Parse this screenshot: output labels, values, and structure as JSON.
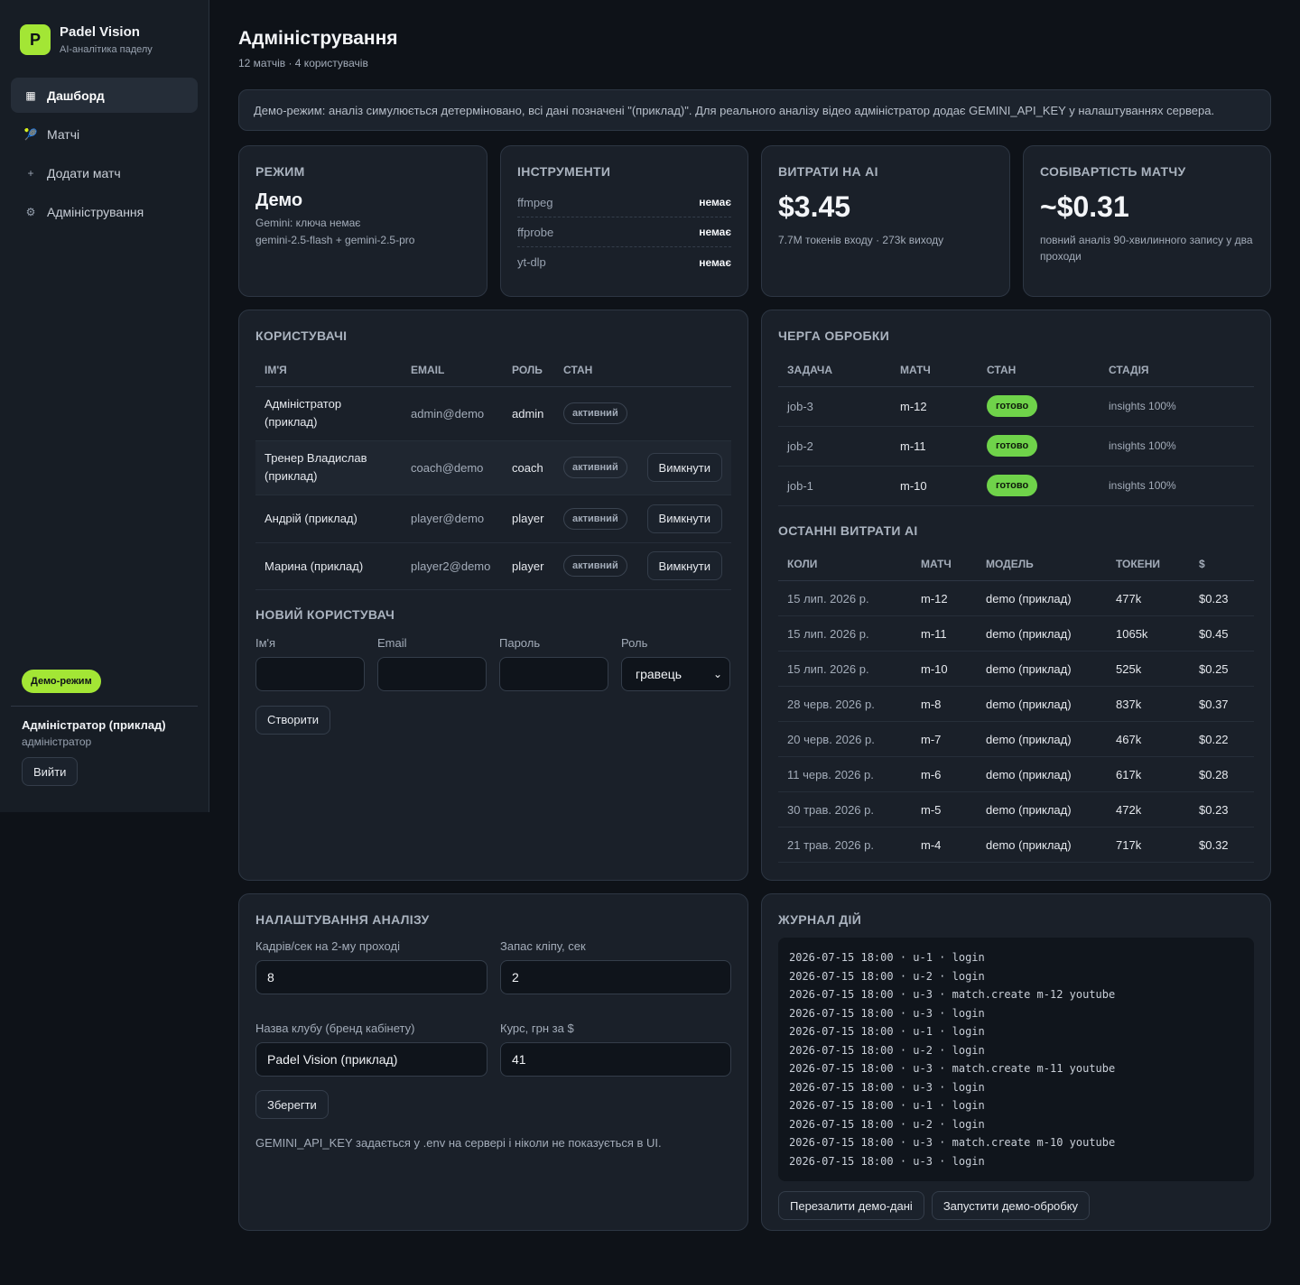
{
  "brand": {
    "logo_letter": "P",
    "name": "Padel Vision",
    "subtitle": "AI-аналітика паделу"
  },
  "nav": [
    {
      "icon": "dashboard-icon",
      "label": "Дашборд",
      "active": true
    },
    {
      "icon": "racket-icon",
      "label": "Матчі"
    },
    {
      "icon": "plus-icon",
      "label": "Додати матч"
    },
    {
      "icon": "gear-icon",
      "label": "Адміністрування"
    }
  ],
  "sidebar_footer": {
    "demo_badge": "Демо-режим",
    "user_name": "Адміністратор (приклад)",
    "user_role": "адміністратор",
    "logout": "Вийти"
  },
  "page": {
    "title": "Адміністрування",
    "subtitle": "12 матчів · 4 користувачів"
  },
  "notice": "Демо-режим: аналіз симулюється детерміновано, всі дані позначені \"(приклад)\". Для реального аналізу відео адміністратор додає GEMINI_API_KEY у налаштуваннях сервера.",
  "mode": {
    "title": "Режим",
    "value": "Демо",
    "line1": "Gemini: ключа немає",
    "line2": "gemini-2.5-flash + gemini-2.5-pro"
  },
  "tools": {
    "title": "Інструменти",
    "items": [
      {
        "name": "ffmpeg",
        "status": "немає"
      },
      {
        "name": "ffprobe",
        "status": "немає"
      },
      {
        "name": "yt-dlp",
        "status": "немає"
      }
    ]
  },
  "ai_cost": {
    "title": "Витрати на AI",
    "value": "$3.45",
    "sub": "7.7M токенів входу · 273k виходу"
  },
  "match_cost": {
    "title": "Собівартість матчу",
    "value": "~$0.31",
    "sub": "повний аналіз 90-хвилинного запису у два проходи"
  },
  "users": {
    "title": "Користувачі",
    "columns": [
      "Ім'я",
      "Email",
      "Роль",
      "Стан"
    ],
    "rows": [
      {
        "name": "Адміністратор (приклад)",
        "email": "admin@demo",
        "role": "admin",
        "state": "активний",
        "action": ""
      },
      {
        "name": "Тренер Владислав (приклад)",
        "email": "coach@demo",
        "role": "coach",
        "state": "активний",
        "action": "Вимкнути"
      },
      {
        "name": "Андрій (приклад)",
        "email": "player@demo",
        "role": "player",
        "state": "активний",
        "action": "Вимкнути"
      },
      {
        "name": "Марина (приклад)",
        "email": "player2@demo",
        "role": "player",
        "state": "активний",
        "action": "Вимкнути"
      }
    ]
  },
  "new_user": {
    "title": "Новий користувач",
    "name_label": "Ім'я",
    "email_label": "Email",
    "password_label": "Пароль",
    "role_label": "Роль",
    "role_value": "гравець",
    "create": "Створити"
  },
  "queue": {
    "title": "Черга обробки",
    "columns": [
      "Задача",
      "Матч",
      "Стан",
      "Стадія"
    ],
    "rows": [
      {
        "job": "job-3",
        "match": "m-12",
        "state": "готово",
        "stage": "insights 100%"
      },
      {
        "job": "job-2",
        "match": "m-11",
        "state": "готово",
        "stage": "insights 100%"
      },
      {
        "job": "job-1",
        "match": "m-10",
        "state": "готово",
        "stage": "insights 100%"
      }
    ]
  },
  "costs": {
    "title": "Останні витрати AI",
    "columns": [
      "Коли",
      "Матч",
      "Модель",
      "Токени",
      "$"
    ],
    "rows": [
      {
        "when": "15 лип. 2026 р.",
        "match": "m-12",
        "model": "demo (приклад)",
        "tokens": "477k",
        "usd": "$0.23"
      },
      {
        "when": "15 лип. 2026 р.",
        "match": "m-11",
        "model": "demo (приклад)",
        "tokens": "1065k",
        "usd": "$0.45"
      },
      {
        "when": "15 лип. 2026 р.",
        "match": "m-10",
        "model": "demo (приклад)",
        "tokens": "525k",
        "usd": "$0.25"
      },
      {
        "when": "28 черв. 2026 р.",
        "match": "m-8",
        "model": "demo (приклад)",
        "tokens": "837k",
        "usd": "$0.37"
      },
      {
        "when": "20 черв. 2026 р.",
        "match": "m-7",
        "model": "demo (приклад)",
        "tokens": "467k",
        "usd": "$0.22"
      },
      {
        "when": "11 черв. 2026 р.",
        "match": "m-6",
        "model": "demo (приклад)",
        "tokens": "617k",
        "usd": "$0.28"
      },
      {
        "when": "30 трав. 2026 р.",
        "match": "m-5",
        "model": "demo (приклад)",
        "tokens": "472k",
        "usd": "$0.23"
      },
      {
        "when": "21 трав. 2026 р.",
        "match": "m-4",
        "model": "demo (приклад)",
        "tokens": "717k",
        "usd": "$0.32"
      }
    ]
  },
  "settings": {
    "title": "Налаштування аналізу",
    "fps_label": "Кадрів/сек на 2-му проході",
    "fps_value": "8",
    "clip_label": "Запас кліпу, сек",
    "clip_value": "2",
    "club_label": "Назва клубу (бренд кабінету)",
    "club_value": "Padel Vision (приклад)",
    "rate_label": "Курс, грн за $",
    "rate_value": "41",
    "save": "Зберегти",
    "note": "GEMINI_API_KEY задається у .env на сервері і ніколи не показується в UI."
  },
  "log": {
    "title": "Журнал дій",
    "lines": [
      "2026-07-15 18:00 · u-1 · login",
      "2026-07-15 18:00 · u-2 · login",
      "2026-07-15 18:00 · u-3 · match.create m-12 youtube",
      "2026-07-15 18:00 · u-3 · login",
      "2026-07-15 18:00 · u-1 · login",
      "2026-07-15 18:00 · u-2 · login",
      "2026-07-15 18:00 · u-3 · match.create m-11 youtube",
      "2026-07-15 18:00 · u-3 · login",
      "2026-07-15 18:00 · u-1 · login",
      "2026-07-15 18:00 · u-2 · login",
      "2026-07-15 18:00 · u-3 · match.create m-10 youtube",
      "2026-07-15 18:00 · u-3 · login"
    ],
    "reload": "Перезалити демо-дані",
    "run": "Запустити демо-обробку"
  }
}
